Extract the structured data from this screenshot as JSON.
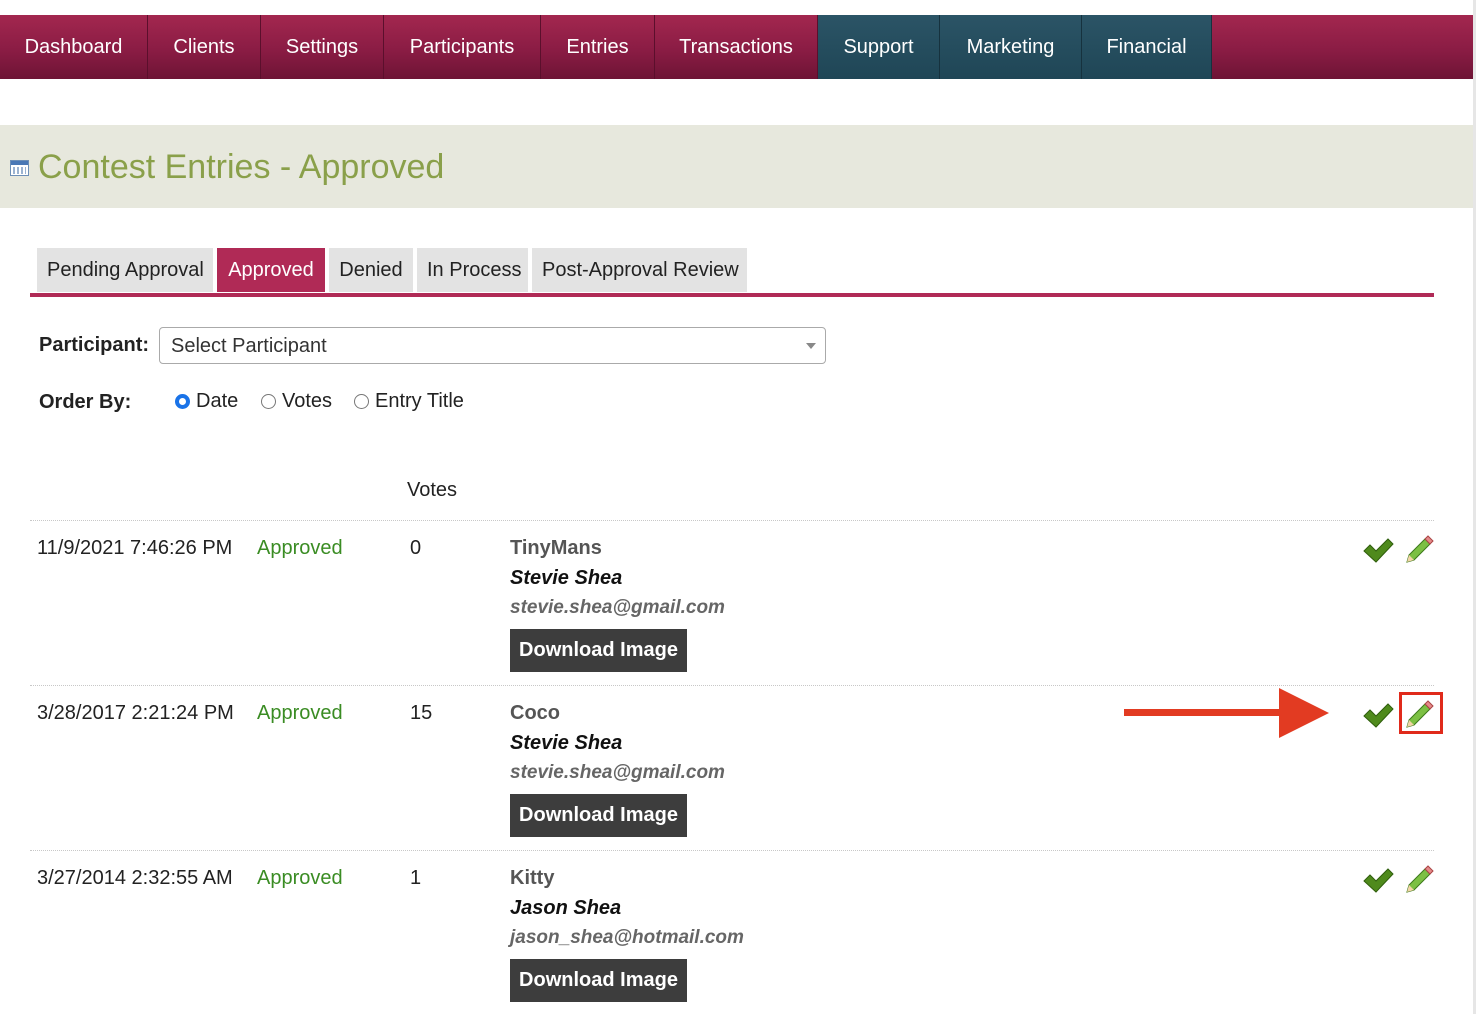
{
  "nav": {
    "items": [
      {
        "label": "Dashboard"
      },
      {
        "label": "Clients"
      },
      {
        "label": "Settings"
      },
      {
        "label": "Participants"
      },
      {
        "label": "Entries"
      },
      {
        "label": "Transactions"
      },
      {
        "label": "Support"
      },
      {
        "label": "Marketing"
      },
      {
        "label": "Financial"
      }
    ]
  },
  "page": {
    "title": "Contest Entries - Approved",
    "title_icon": "calendar-icon"
  },
  "tabs": [
    {
      "label": "Pending Approval",
      "active": false
    },
    {
      "label": "Approved",
      "active": true
    },
    {
      "label": "Denied",
      "active": false
    },
    {
      "label": "In Process",
      "active": false
    },
    {
      "label": "Post-Approval Review",
      "active": false
    }
  ],
  "filters": {
    "participant_label": "Participant:",
    "participant_value": "Select Participant",
    "order_label": "Order By:",
    "order_options": [
      {
        "label": "Date",
        "selected": true
      },
      {
        "label": "Votes",
        "selected": false
      },
      {
        "label": "Entry Title",
        "selected": false
      }
    ]
  },
  "table": {
    "votes_header": "Votes",
    "download_label": "Download Image",
    "rows": [
      {
        "date": "11/9/2021 7:46:26 PM",
        "status": "Approved",
        "votes": "0",
        "title": "TinyMans",
        "name": "Stevie Shea",
        "email": "stevie.shea@gmail.com"
      },
      {
        "date": "3/28/2017 2:21:24 PM",
        "status": "Approved",
        "votes": "15",
        "title": "Coco",
        "name": "Stevie Shea",
        "email": "stevie.shea@gmail.com"
      },
      {
        "date": "3/27/2014 2:32:55 AM",
        "status": "Approved",
        "votes": "1",
        "title": "Kitty",
        "name": "Jason Shea",
        "email": "jason_shea@hotmail.com"
      }
    ]
  },
  "colors": {
    "nav_primary": "#8a1c44",
    "nav_secondary": "#1f4656",
    "accent": "#b02a56",
    "title": "#8aa04a",
    "status_approved": "#3a8c23",
    "annotation": "#e23b22"
  },
  "icons": {
    "approve": "checkmark-icon",
    "edit": "pencil-icon"
  }
}
